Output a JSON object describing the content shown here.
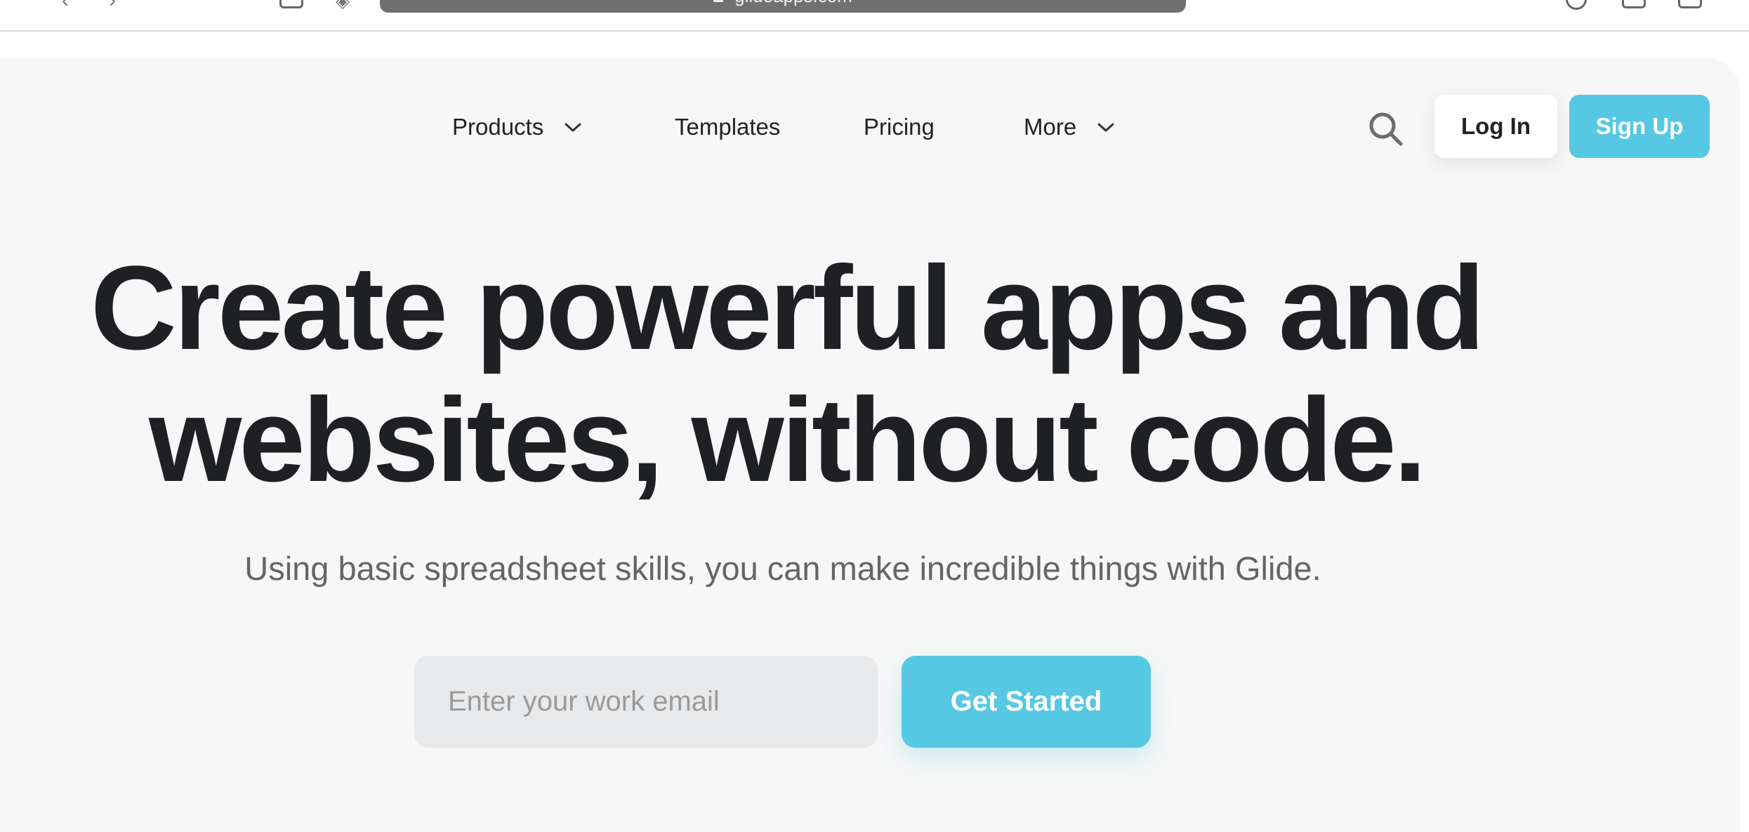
{
  "browser": {
    "address": "glideapps.com"
  },
  "nav": {
    "items": [
      {
        "label": "Products",
        "has_dropdown": true
      },
      {
        "label": "Templates",
        "has_dropdown": false
      },
      {
        "label": "Pricing",
        "has_dropdown": false
      },
      {
        "label": "More",
        "has_dropdown": true
      }
    ],
    "search_icon": "search-icon",
    "login_label": "Log In",
    "signup_label": "Sign Up"
  },
  "hero": {
    "title_line1": "Create powerful apps and",
    "title_line2": "websites, without code.",
    "subtitle": "Using basic spreadsheet skills, you can make incredible things with Glide."
  },
  "form": {
    "email_placeholder": "Enter your work email",
    "cta_label": "Get Started"
  },
  "colors": {
    "accent": "#56c8e3",
    "page_background": "#f7f7f7",
    "heading": "#1f2023"
  }
}
